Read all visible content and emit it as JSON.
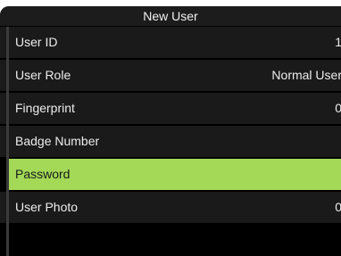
{
  "title": "New User",
  "menu": {
    "items": [
      {
        "label": "User ID",
        "value": "1"
      },
      {
        "label": "User Role",
        "value": "Normal User"
      },
      {
        "label": "Fingerprint",
        "value": "0"
      },
      {
        "label": "Badge Number",
        "value": ""
      },
      {
        "label": "Password",
        "value": ""
      },
      {
        "label": "User Photo",
        "value": "0"
      }
    ],
    "selected_index": 4
  },
  "colors": {
    "screen_bg": "#000000",
    "row_bg": "#1a1a1a",
    "selected_bg": "#a3d957",
    "text": "#ededed"
  }
}
